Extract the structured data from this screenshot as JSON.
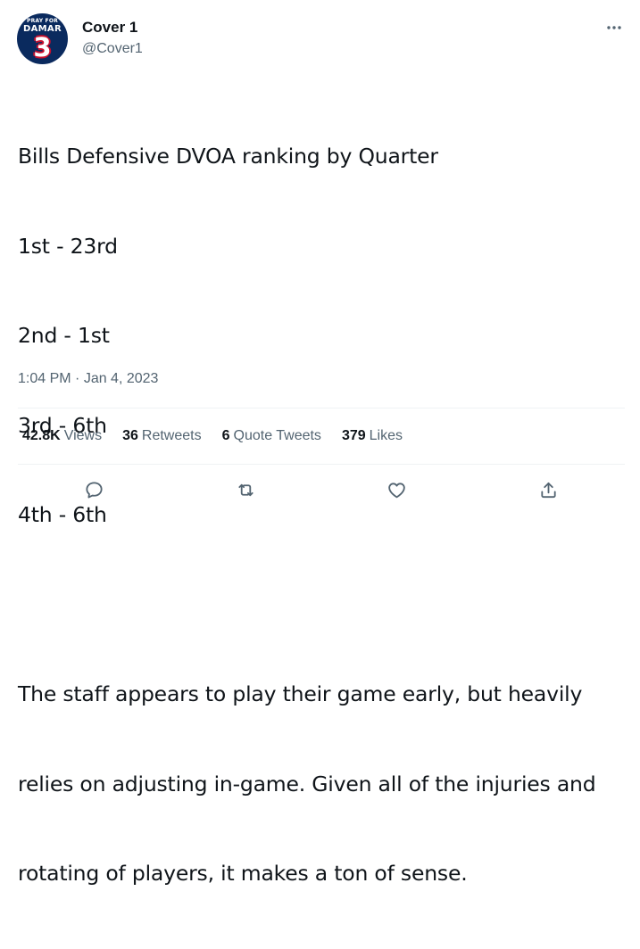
{
  "author": {
    "display_name": "Cover 1",
    "handle": "@Cover1",
    "avatar": {
      "text_line1": "PRAY FOR",
      "text_line2": "DAMAR",
      "number": "3",
      "bg_color": "#0a2a5e",
      "accent_color": "#c8102e"
    }
  },
  "tweet": {
    "lines": [
      "Bills Defensive DVOA ranking by Quarter",
      "1st - 23rd",
      "2nd - 1st",
      "3rd - 6th",
      "4th - 6th",
      "",
      "The staff appears to play their game early, but heavily",
      "relies on adjusting in-game. Given all of the injuries and",
      "rotating of players, it makes a ton of sense."
    ],
    "time": "1:04 PM",
    "separator": " · ",
    "date": "Jan 4, 2023"
  },
  "stats": {
    "views": {
      "count": "42.8K",
      "label": "Views"
    },
    "retweets": {
      "count": "36",
      "label": "Retweets"
    },
    "quote_tweets": {
      "count": "6",
      "label": "Quote Tweets"
    },
    "likes": {
      "count": "379",
      "label": "Likes"
    }
  },
  "actions": [
    "reply-icon",
    "retweet-icon",
    "like-icon",
    "share-icon"
  ],
  "colors": {
    "text_primary": "#0f1419",
    "text_secondary": "#536471",
    "divider": "#eff3f4"
  }
}
